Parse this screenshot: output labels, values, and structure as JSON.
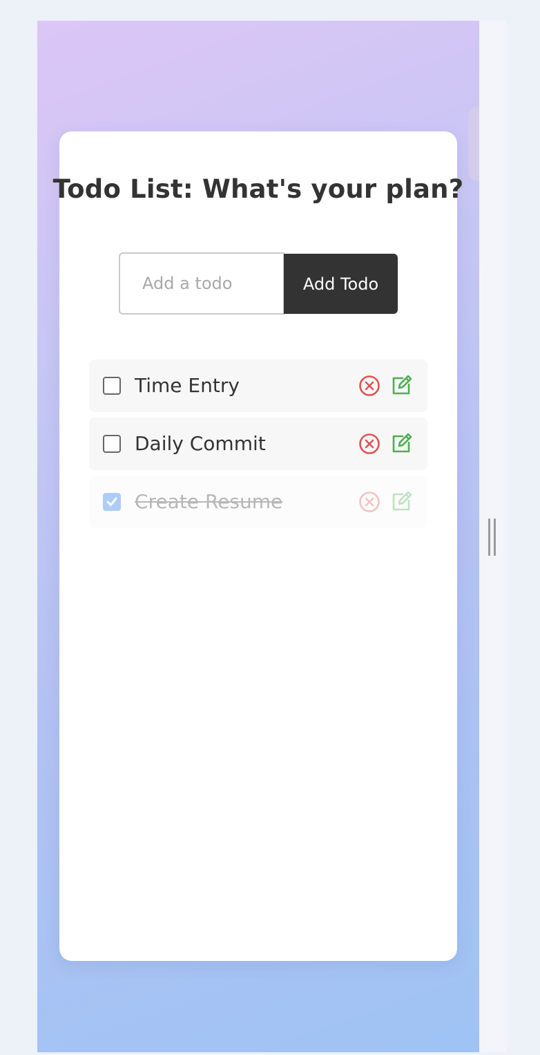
{
  "app": {
    "title": "Todo List: What's your plan?"
  },
  "form": {
    "input_placeholder": "Add a todo",
    "input_value": "",
    "add_button_label": "Add Todo"
  },
  "todos": [
    {
      "text": "Time Entry",
      "completed": false
    },
    {
      "text": "Daily Commit",
      "completed": false
    },
    {
      "text": "Create Resume",
      "completed": true
    }
  ],
  "icons": {
    "delete": "x-circle-icon",
    "edit": "edit-icon",
    "check": "checkmark-icon"
  },
  "colors": {
    "delete": "#e05252",
    "edit": "#4caf50",
    "checked": "#1a73e8",
    "button_bg": "#333333",
    "title": "#333333"
  }
}
